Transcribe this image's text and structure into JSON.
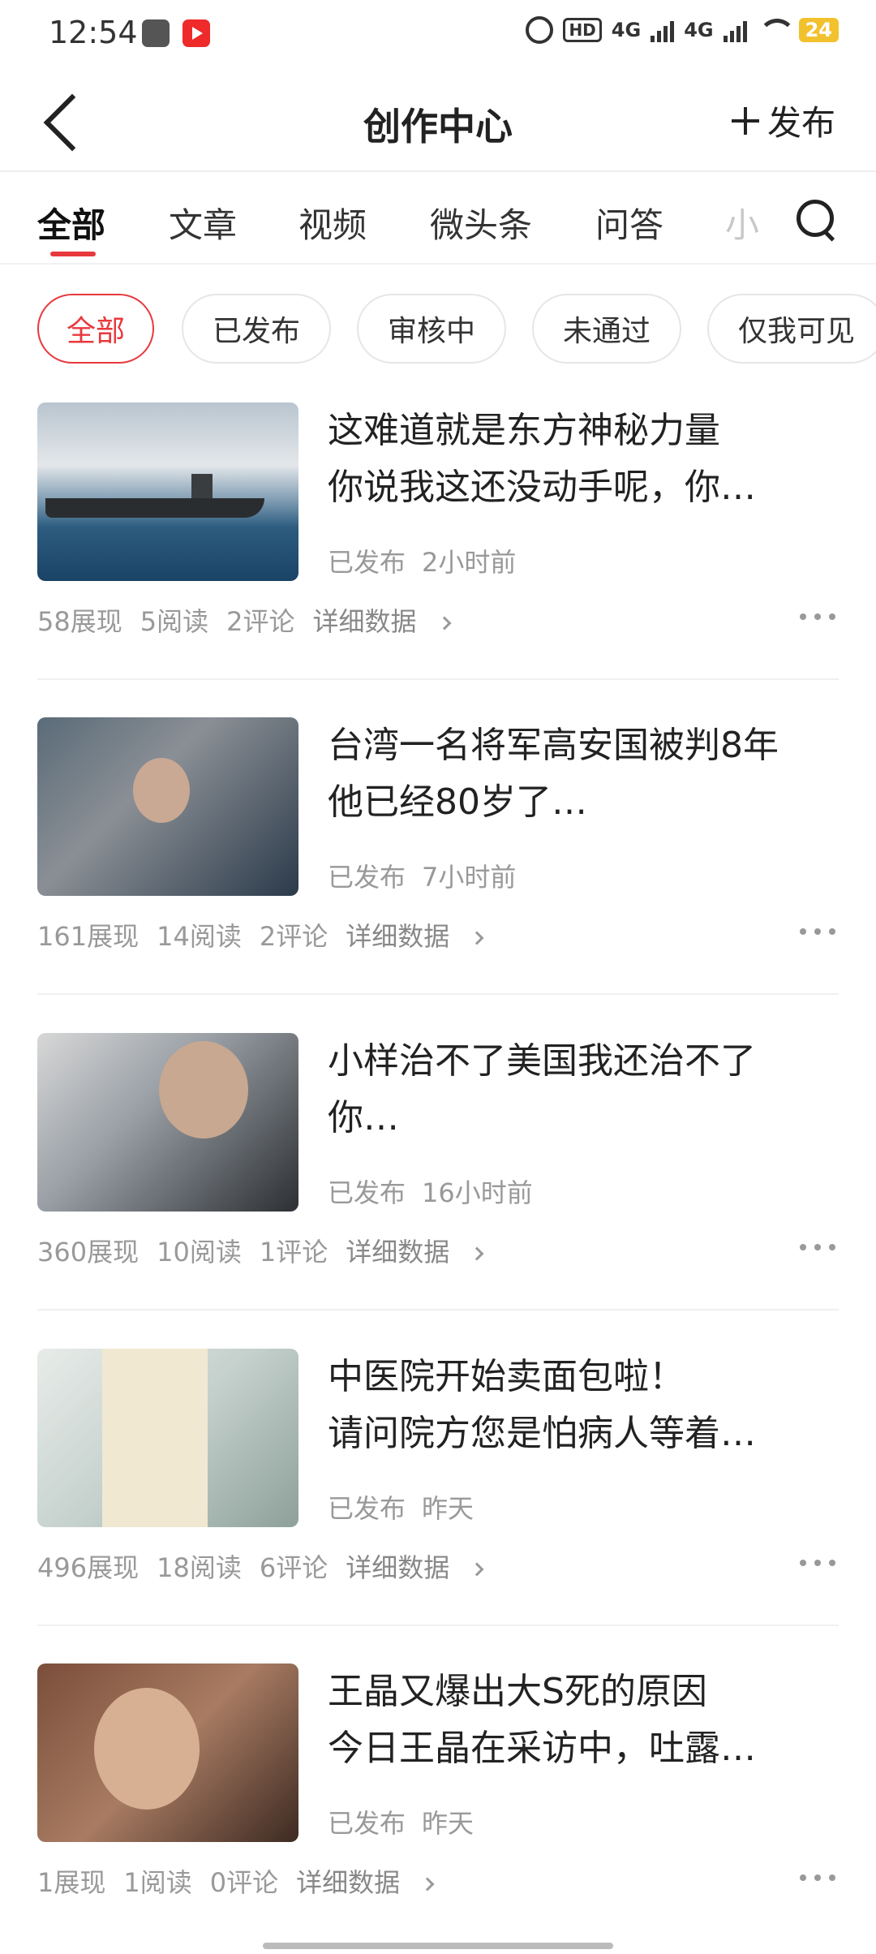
{
  "status_bar": {
    "time": "12:54",
    "battery": "24",
    "hd_label": "HD",
    "network_1": "4G",
    "network_2": "4G"
  },
  "header": {
    "title": "创作中心",
    "publish_label": "发布"
  },
  "tabs": [
    {
      "label": "全部",
      "active": true
    },
    {
      "label": "文章",
      "active": false
    },
    {
      "label": "视频",
      "active": false
    },
    {
      "label": "微头条",
      "active": false
    },
    {
      "label": "问答",
      "active": false
    },
    {
      "label": "小",
      "active": false
    }
  ],
  "filters": [
    {
      "label": "全部",
      "active": true
    },
    {
      "label": "已发布",
      "active": false
    },
    {
      "label": "审核中",
      "active": false
    },
    {
      "label": "未通过",
      "active": false
    },
    {
      "label": "仅我可见",
      "active": false
    }
  ],
  "articles": [
    {
      "title_line1": "这难道就是东方神秘力量",
      "title_line2": "你说我这还没动手呢，你…",
      "status": "已发布",
      "time": "2小时前",
      "impressions": "58展现",
      "reads": "5阅读",
      "comments": "2评论",
      "detail_label": "详细数据"
    },
    {
      "title_line1": "台湾一名将军高安国被判8年",
      "title_line2": "他已经80岁了…",
      "status": "已发布",
      "time": "7小时前",
      "impressions": "161展现",
      "reads": "14阅读",
      "comments": "2评论",
      "detail_label": "详细数据"
    },
    {
      "title_line1": "小样治不了美国我还治不了",
      "title_line2": "你…",
      "status": "已发布",
      "time": "16小时前",
      "impressions": "360展现",
      "reads": "10阅读",
      "comments": "1评论",
      "detail_label": "详细数据"
    },
    {
      "title_line1": "中医院开始卖面包啦！",
      "title_line2": "请问院方您是怕病人等着…",
      "status": "已发布",
      "time": "昨天",
      "impressions": "496展现",
      "reads": "18阅读",
      "comments": "6评论",
      "detail_label": "详细数据"
    },
    {
      "title_line1": "王晶又爆出大S死的原因",
      "title_line2": "今日王晶在采访中，吐露…",
      "status": "已发布",
      "time": "昨天",
      "impressions": "1展现",
      "reads": "1阅读",
      "comments": "0评论",
      "detail_label": "详细数据"
    }
  ],
  "colors": {
    "accent": "#e8383d",
    "text": "#222222",
    "muted": "#999999"
  }
}
